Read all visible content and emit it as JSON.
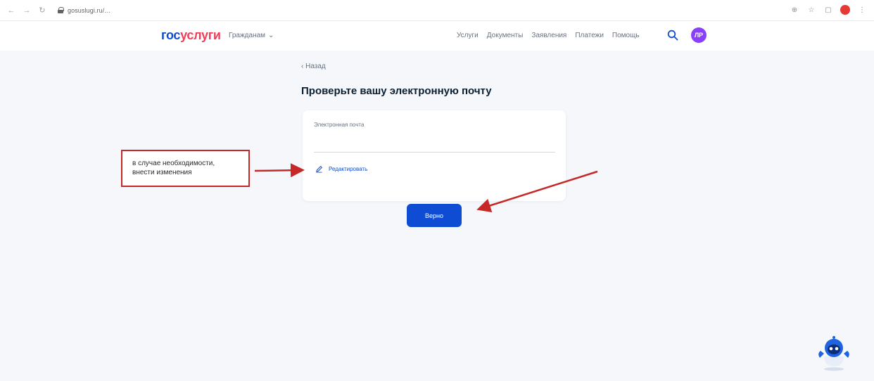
{
  "browser": {
    "url": "gosuslugi.ru/…"
  },
  "header": {
    "logo_part1": "гос",
    "logo_part2": "услуги",
    "citizen_label": "Гражданам",
    "nav": [
      "Услуги",
      "Документы",
      "Заявления",
      "Платежи",
      "Помощь"
    ],
    "avatar_initials": "ЛР"
  },
  "main": {
    "back_label": "‹ Назад",
    "title": "Проверьте вашу электронную почту",
    "card": {
      "field_label": "Электронная почта",
      "field_value": "",
      "edit_label": "Редактировать"
    },
    "next_button": "Верно"
  },
  "annotation": {
    "line1": "в случае необходимости,",
    "line2": "внести изменения"
  },
  "colors": {
    "brand_blue": "#0d4cd3",
    "brand_red": "#ee3f58",
    "annotation_red": "#c62828",
    "avatar_purple": "#8a3ffc"
  }
}
